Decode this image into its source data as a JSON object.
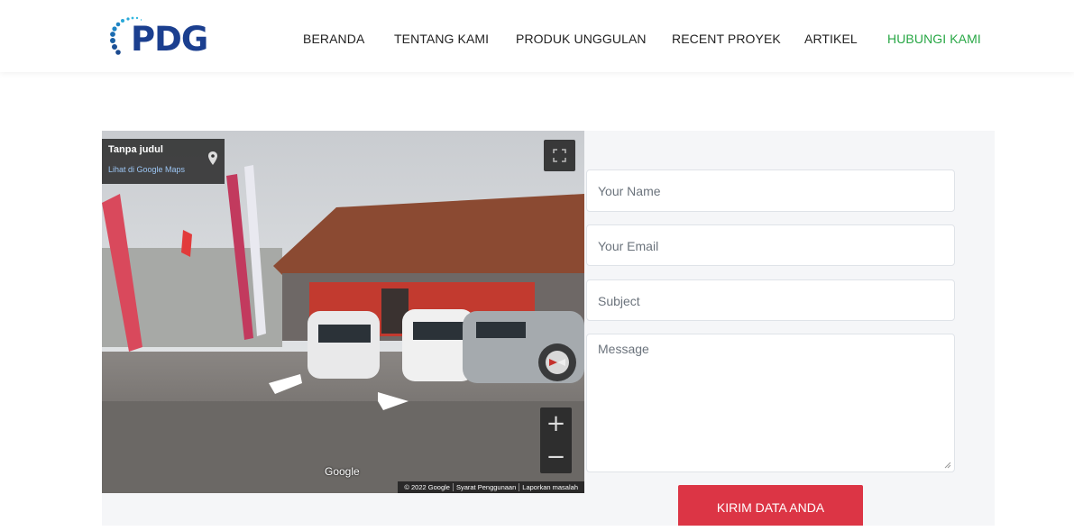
{
  "header": {
    "logo_text": "PDG",
    "nav": [
      {
        "label": "BERANDA"
      },
      {
        "label": "TENTANG KAMI"
      },
      {
        "label": "PRODUK UNGGULAN"
      },
      {
        "label": "RECENT PROYEK"
      },
      {
        "label": "ARTIKEL"
      },
      {
        "label": "HUBUNGI KAMI",
        "active": true
      }
    ]
  },
  "map": {
    "title": "Tanpa judul",
    "link": "Lihat di Google Maps",
    "google": "Google",
    "footer": [
      "© 2022 Google",
      "Syarat Penggunaan",
      "Laporkan masalah"
    ],
    "zoom_in": "+",
    "zoom_out": "−"
  },
  "form": {
    "name_placeholder": "Your Name",
    "email_placeholder": "Your Email",
    "subject_placeholder": "Subject",
    "message_placeholder": "Message",
    "submit_label": "KIRIM DATA ANDA"
  },
  "colors": {
    "brand": "#1b3f8f",
    "active_nav": "#28a745",
    "submit": "#dc3545"
  }
}
